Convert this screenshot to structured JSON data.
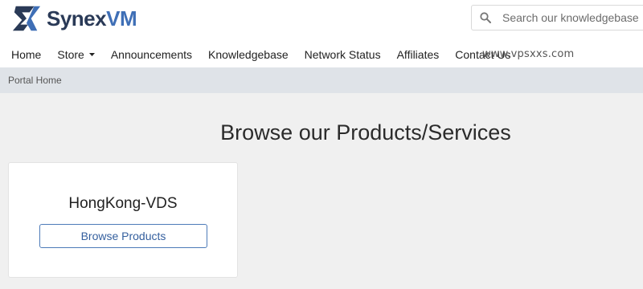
{
  "brand": {
    "name_primary": "Synex",
    "name_accent": "VM",
    "colors": {
      "dark": "#2a3a57",
      "accent": "#3f6fb6"
    },
    "logo_icon": "synexvm-logo-mark"
  },
  "search": {
    "placeholder": "Search our knowledgebase...",
    "value": "",
    "icon": "search-icon"
  },
  "nav": {
    "items": [
      {
        "label": "Home"
      },
      {
        "label": "Store",
        "icon": "caret-down-icon"
      },
      {
        "label": "Announcements"
      },
      {
        "label": "Knowledgebase"
      },
      {
        "label": "Network Status"
      },
      {
        "label": "Affiliates"
      },
      {
        "label": "Contact Us"
      }
    ]
  },
  "watermark": "www.vpsxxs.com",
  "breadcrumb": {
    "item": "Portal Home"
  },
  "main": {
    "title": "Browse our Products/Services",
    "cards": [
      {
        "title": "HongKong-VDS",
        "button_label": "Browse Products"
      }
    ]
  }
}
